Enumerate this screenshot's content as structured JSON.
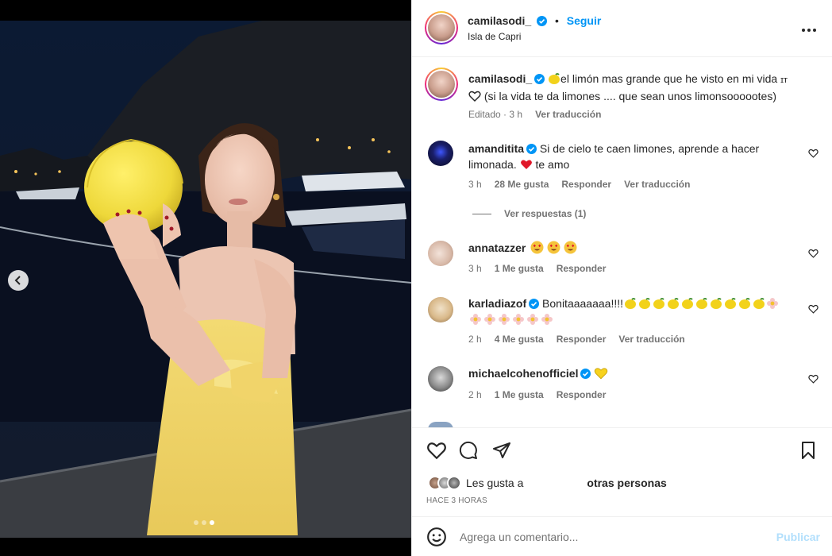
{
  "post": {
    "author": "camilasodi_",
    "location": "Isla de Capri",
    "follow_label": "Seguir",
    "separator": "•",
    "carousel": {
      "slide_count": 3,
      "active_slide": 3
    }
  },
  "caption": {
    "author": "camilasodi_",
    "text_line1": "el limón mas grande que he visto en mi vida",
    "text_line1_suffix": "ɪᴛ",
    "text_line2": "(si la vida te da limones .... que sean unos limonsoooootes)",
    "edited": "Editado",
    "time": "3 h",
    "translate": "Ver traducción"
  },
  "comments": [
    {
      "user": "amanditita",
      "verified": true,
      "text_line1": "Si de cielo te caen limones, aprende a hacer",
      "text_line2a": "limonada.",
      "text_line2b": "te amo",
      "time": "3 h",
      "likes": "28 Me gusta",
      "reply": "Responder",
      "translate": "Ver traducción",
      "replies": "Ver respuestas (1)"
    },
    {
      "user": "annatazzer",
      "verified": false,
      "time": "3 h",
      "likes": "1 Me gusta",
      "reply": "Responder"
    },
    {
      "user": "karladiazof",
      "verified": true,
      "text": "Bonitaaaaaaa!!!!",
      "time": "2 h",
      "likes": "4 Me gusta",
      "reply": "Responder",
      "translate": "Ver traducción"
    },
    {
      "user": "michaelcohenofficiel",
      "verified": true,
      "time": "2 h",
      "likes": "1 Me gusta",
      "reply": "Responder"
    }
  ],
  "likes_row": {
    "prefix": "Les gusta a",
    "suffix": "otras personas"
  },
  "timestamp": "HACE 3 HORAS",
  "add_comment": {
    "placeholder": "Agrega un comentario...",
    "publish": "Publicar"
  },
  "colors": {
    "accent": "#0095f6",
    "verified": "#0095f6",
    "muted": "#737373",
    "publish_disabled": "#b2dffc"
  },
  "icons": [
    "more-icon",
    "heart-icon",
    "comment-icon",
    "share-icon",
    "bookmark-icon",
    "emoji-icon",
    "chevron-left-icon",
    "verified-icon"
  ]
}
